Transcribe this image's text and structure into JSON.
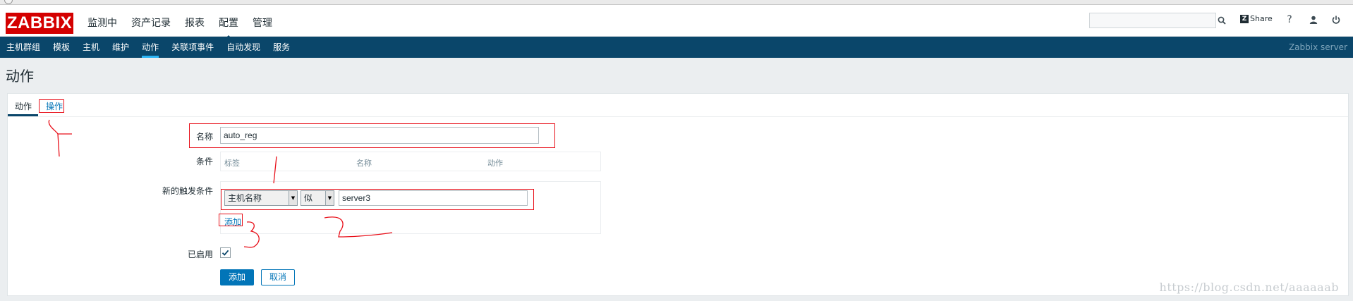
{
  "header": {
    "logo": "ZABBIX",
    "main_menu": [
      "监测中",
      "资产记录",
      "报表",
      "配置",
      "管理"
    ],
    "active_menu": "配置",
    "share_label": "Share",
    "help_icon": "?"
  },
  "sub_nav": {
    "items": [
      "主机群组",
      "模板",
      "主机",
      "维护",
      "动作",
      "关联项事件",
      "自动发现",
      "服务"
    ],
    "active": "动作",
    "server_name": "Zabbix server"
  },
  "page": {
    "title": "动作"
  },
  "tabs": {
    "action": "动作",
    "operations": "操作"
  },
  "form": {
    "name_label": "名称",
    "name_value": "auto_reg",
    "conditions_label": "条件",
    "conditions_headers": [
      "标签",
      "名称",
      "动作"
    ],
    "new_condition_label": "新的触发条件",
    "condition_type": "主机名称",
    "condition_operator": "似",
    "condition_value": "server3",
    "add_link": "添加",
    "enabled_label": "已启用",
    "enabled": true,
    "add_button": "添加",
    "cancel_button": "取消"
  },
  "icons": {
    "search": "search-icon",
    "help": "help-icon",
    "user": "user-icon",
    "power": "power-icon",
    "check": "check-icon"
  },
  "colors": {
    "logo_bg": "#d40000",
    "nav_bg": "#0a466a",
    "accent": "#0275b8",
    "annotation": "#e8101a"
  },
  "watermark": "https://blog.csdn.net/aaaaaab"
}
